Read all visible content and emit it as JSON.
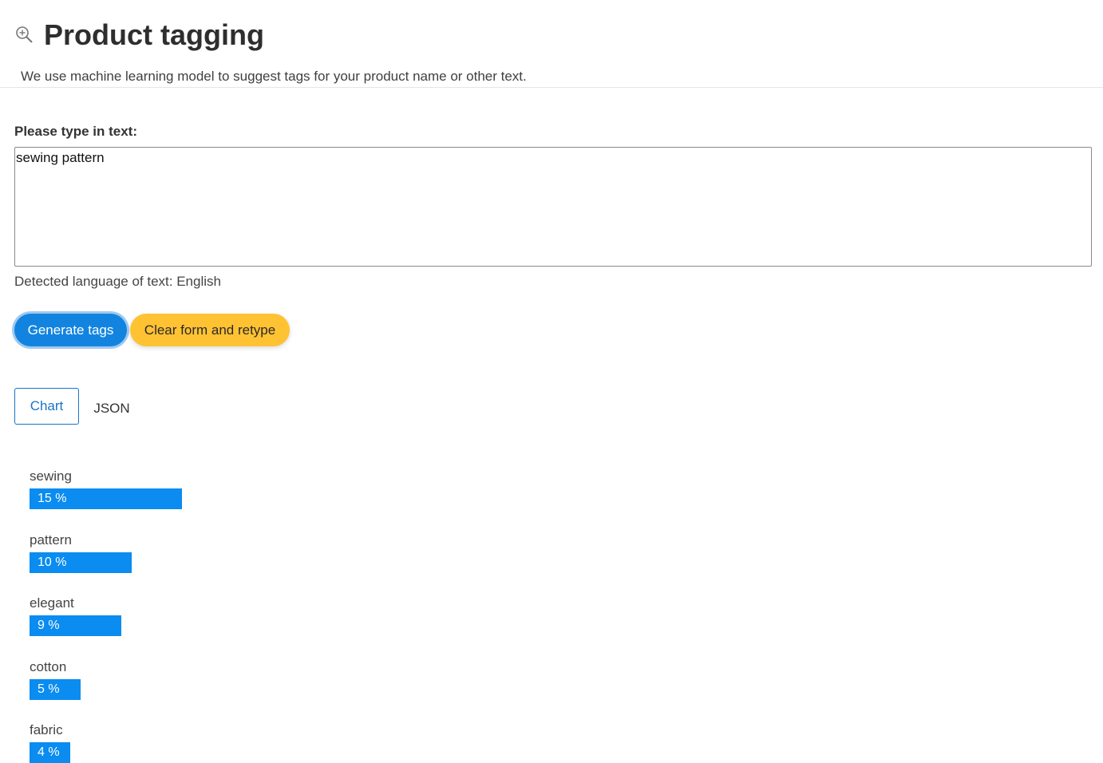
{
  "header": {
    "icon": "zoom-in-icon",
    "title": "Product tagging",
    "subtitle": "We use machine learning model to suggest tags for your product name or other text."
  },
  "form": {
    "label": "Please type in text:",
    "text_value": "sewing pattern",
    "detected_language": "Detected language of text: English"
  },
  "buttons": {
    "generate": "Generate tags",
    "clear": "Clear form and retype"
  },
  "tabs": {
    "chart": "Chart",
    "json": "JSON",
    "active": "Chart"
  },
  "colors": {
    "primary": "#1284e0",
    "accent": "#ffc233",
    "bar": "#0a8cf0"
  },
  "chart_data": {
    "type": "bar",
    "categories": [
      "sewing",
      "pattern",
      "elegant",
      "cotton",
      "fabric"
    ],
    "values": [
      15,
      10,
      9,
      5,
      4
    ],
    "labels": [
      "15 %",
      "10 %",
      "9 %",
      "5 %",
      "4 %"
    ]
  }
}
